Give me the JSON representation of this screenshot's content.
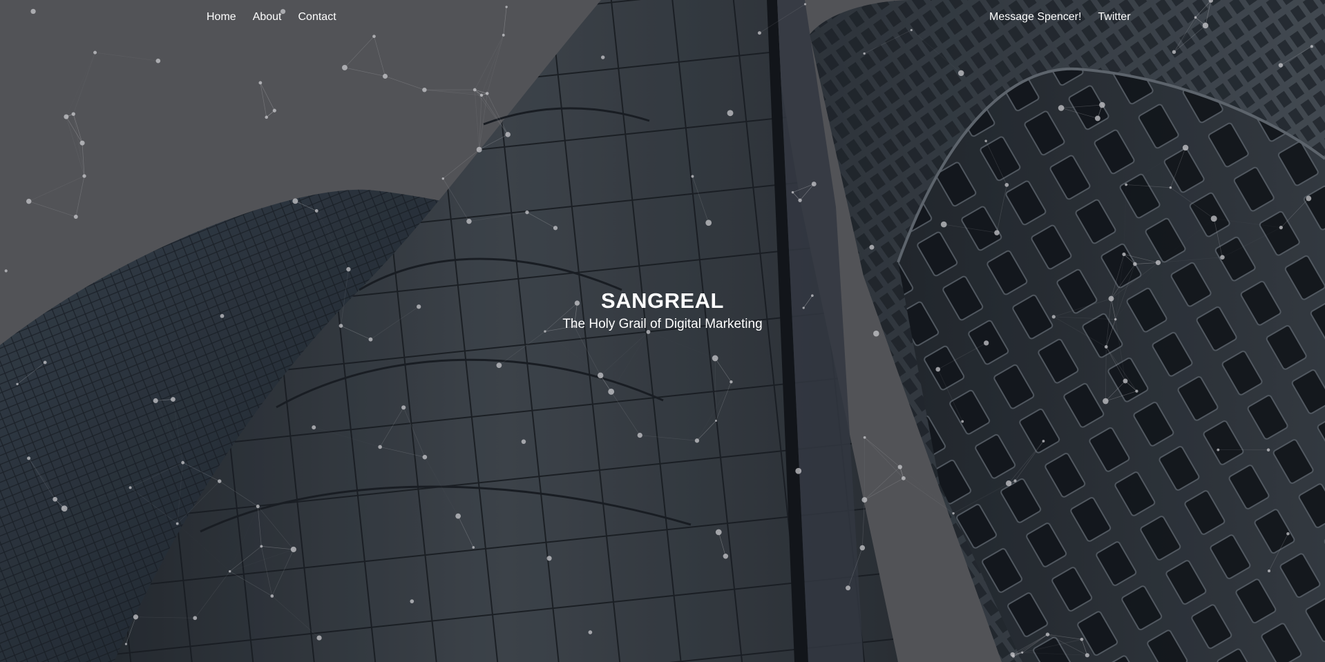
{
  "nav": {
    "left": [
      {
        "label": "Home"
      },
      {
        "label": "About"
      },
      {
        "label": "Contact"
      }
    ],
    "right": [
      {
        "label": "Message Spencer!"
      },
      {
        "label": "Twitter"
      }
    ]
  },
  "hero": {
    "title": "SANGREAL",
    "tagline": "The Holy Grail of Digital Marketing"
  },
  "colors": {
    "sky": "#5e5f63",
    "building_dark": "#2b3138",
    "building_mid": "#3c434b",
    "glass_light": "#5a626b",
    "text": "#ffffff",
    "particle": "#c8c8cc"
  }
}
